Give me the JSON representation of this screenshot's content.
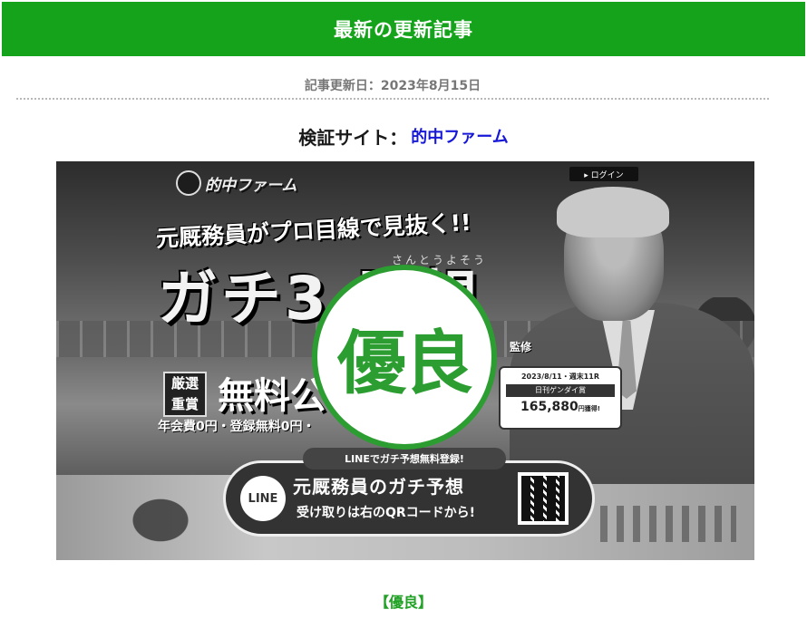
{
  "header": {
    "title": "最新の更新記事"
  },
  "update": {
    "text": "記事更新日：2023年8月15日"
  },
  "site": {
    "label": "検証サイト：",
    "name": "的中ファーム"
  },
  "banner": {
    "logo_text": "的中ファーム",
    "login": "▸ ログイン",
    "catchphrase": "元厩務員がプロ目線で見抜く!!",
    "title": "ガチ3 予想",
    "ruby": "さんとうよそう",
    "supervision": "監修",
    "feature_tag": "厳選\n重賞",
    "feature_text": "無料公",
    "fee_line": "年会費0円・登録無料0円・",
    "result_card": {
      "date": "2023/8/11・週末11R",
      "race": "日刊ゲンダイ賞",
      "amount": "165,880",
      "amount_suffix": "円獲得!"
    },
    "line_label": "LINEでガチ予想無料登録!",
    "line_logo": "LINE",
    "line_title": "元厩務員のガチ予想",
    "line_sub": "受け取りは右のQRコードから!"
  },
  "stamp": {
    "text": "優良"
  },
  "rating": {
    "label": "【優良】"
  },
  "colors": {
    "header_green": "#14a31a",
    "stamp_green": "#2c9d31",
    "link_blue": "#1717d8"
  }
}
